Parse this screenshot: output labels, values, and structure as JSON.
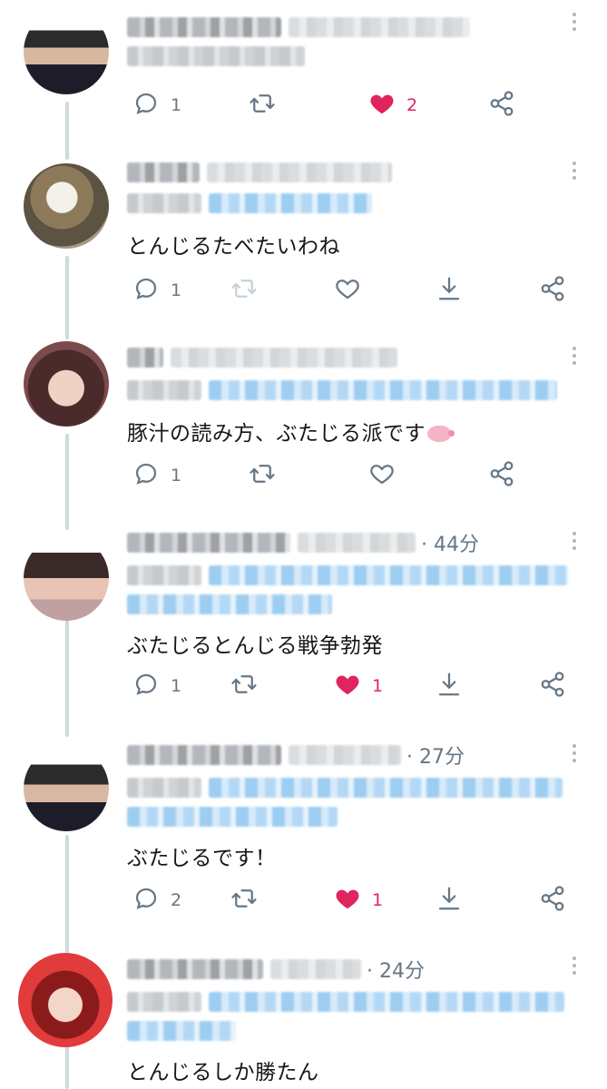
{
  "icons": {
    "reply": "speech-bubble-icon",
    "retweet": "retweet-arrows-icon",
    "like": "heart-icon",
    "download": "download-arrow-icon",
    "share": "share-nodes-icon",
    "more": "vertical-dots-icon"
  },
  "colors": {
    "icon": "#657786",
    "liked": "#e0245e",
    "thread_line": "#cfd9de",
    "mention": "#1da1f2"
  },
  "tweets": [
    {
      "time": "",
      "text": "",
      "reply_count": "1",
      "retweet_enabled": true,
      "liked": true,
      "like_count": "2",
      "has_download": false
    },
    {
      "time": "",
      "text": "とんじるたべたいわね",
      "reply_count": "1",
      "retweet_enabled": false,
      "liked": false,
      "like_count": "",
      "has_download": true
    },
    {
      "time": "",
      "text": "豚汁の読み方、ぶたじる派です",
      "emoji": "pig-icon",
      "reply_count": "1",
      "retweet_enabled": true,
      "liked": false,
      "like_count": "",
      "has_download": false
    },
    {
      "time": "· 44分",
      "text": "ぶたじるとんじる戦争勃発",
      "reply_count": "1",
      "retweet_enabled": true,
      "liked": true,
      "like_count": "1",
      "has_download": true
    },
    {
      "time": "· 27分",
      "text": "ぶたじるです！",
      "reply_count": "2",
      "retweet_enabled": true,
      "liked": true,
      "like_count": "1",
      "has_download": true
    },
    {
      "time": "· 24分",
      "text": "とんじるしか勝たん",
      "reply_count": "",
      "retweet_enabled": true,
      "liked": false,
      "like_count": "",
      "has_download": false
    }
  ]
}
